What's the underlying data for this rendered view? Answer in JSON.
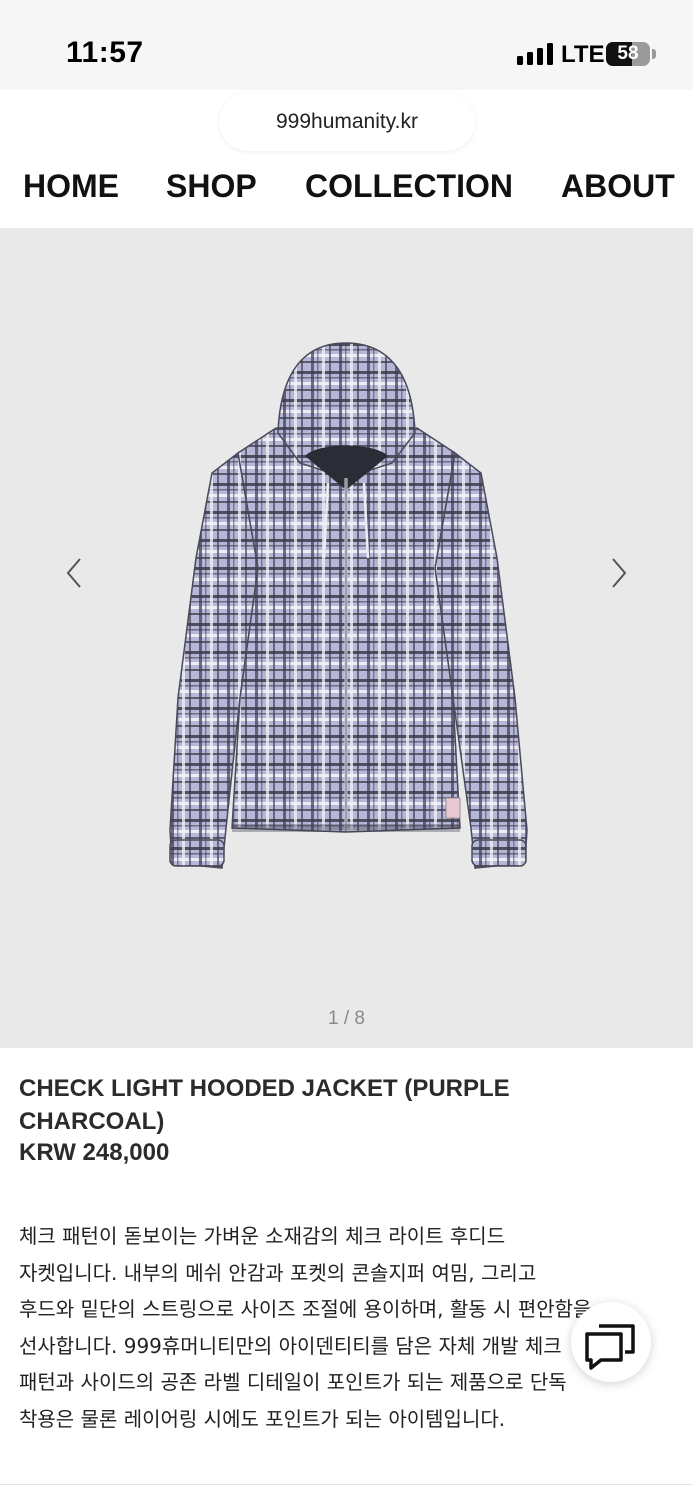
{
  "status_bar": {
    "time": "11:57",
    "network": "LTE",
    "battery_percent": "58",
    "battery_level": 0.58
  },
  "browser": {
    "url": "999humanity.kr"
  },
  "nav": {
    "items": [
      "HOME",
      "SHOP",
      "COLLECTION",
      "ABOUT"
    ]
  },
  "gallery": {
    "counter": "1 / 8"
  },
  "product": {
    "title_line1": "CHECK LIGHT HOODED JACKET (PURPLE",
    "title_line2": "CHARCOAL)",
    "price": "KRW 248,000",
    "description": [
      "체크 패턴이 돋보이는 가벼운 소재감의 체크 라이트 후디드",
      "자켓입니다. 내부의 메쉬 안감과 포켓의 콘솔지퍼 여밈, 그리고",
      "후드와 밑단의 스트링으로 사이즈 조절에 용이하며, 활동 시 편안함을",
      "선사합니다. 999휴머니티만의 아이덴티티를 담은 자체 개발 체크",
      "패턴과 사이드의 공존 라벨 디테일이 포인트가 되는 제품으로 단독",
      "착용은 물론 레이어링 시에도 포인트가 되는 아이템입니다."
    ]
  },
  "colors": {
    "jacket_base": "#b6b6d8",
    "plaid_dark": "#3c3c4c",
    "gallery_bg": "#e9e9e9"
  }
}
